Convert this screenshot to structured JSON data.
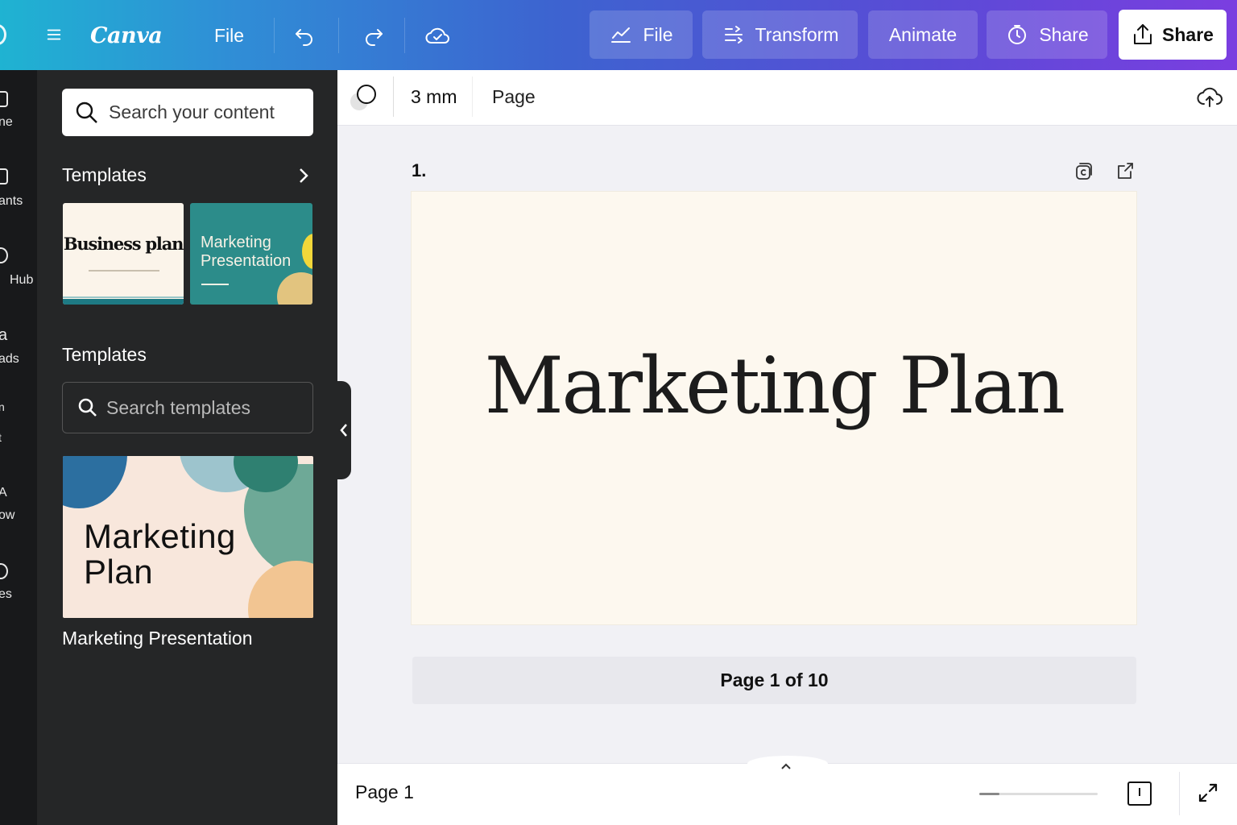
{
  "topbar": {
    "brand": "Canva",
    "file_label": "File",
    "pills": {
      "file": "File",
      "transform": "Transform",
      "animate": "Animate",
      "share": "Share"
    },
    "share_main": "Share",
    "gradient_colors": [
      "#1fb3d2",
      "#3d63d0",
      "#7b3ee0"
    ]
  },
  "rail": {
    "items": [
      {
        "label": "ne",
        "icon": "home-icon"
      },
      {
        "label": "ants",
        "icon": "elements-icon"
      },
      {
        "label": "Hub",
        "icon": "hub-icon"
      },
      {
        "label": "ads",
        "icon": "uploads-icon"
      },
      {
        "label": "t",
        "icon": "text-icon"
      },
      {
        "label": "ow",
        "icon": "draw-icon"
      },
      {
        "label": "es",
        "icon": "apps-icon"
      }
    ]
  },
  "panel": {
    "search_placeholder": "Search your content",
    "section1_title": "Templates",
    "thumb1_title": "Business plan",
    "thumb2_title": "Marketing Presentation",
    "section2_title": "Templates",
    "search_templates_placeholder": "Search templates",
    "big_thumb_title": "Marketing Plan",
    "big_thumb_caption": "Marketing Presentation"
  },
  "toolbar": {
    "size_value": "3 mm",
    "page_label": "Page"
  },
  "canvas": {
    "page_number": "1.",
    "slide_title": "Marketing Plan",
    "page_counter": "Page 1 of 10",
    "slide_bg": "#fdf8ef"
  },
  "footer": {
    "page_label": "Page 1",
    "zoom_fraction": 0.17
  }
}
